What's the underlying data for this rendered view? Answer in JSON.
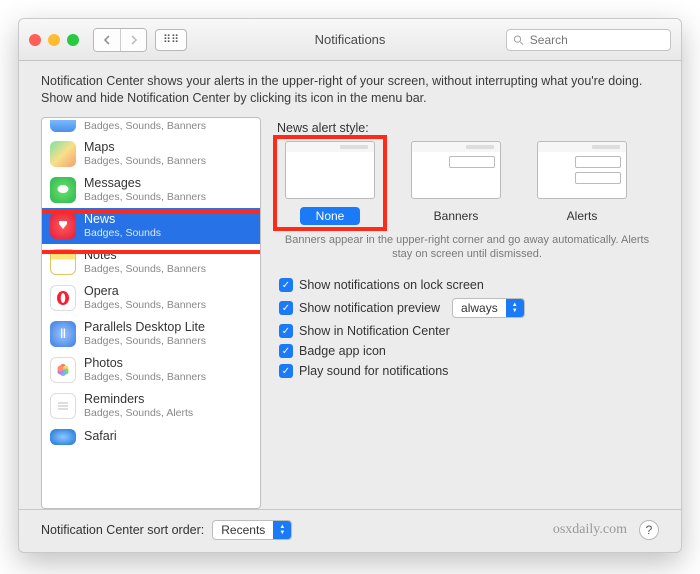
{
  "titlebar": {
    "title": "Notifications",
    "search_placeholder": "Search"
  },
  "description": "Notification Center shows your alerts in the upper-right of your screen, without interrupting what you're doing. Show and hide Notification Center by clicking its icon in the menu bar.",
  "sidebar": {
    "items": [
      {
        "name": "",
        "sub": "Badges, Sounds, Banners"
      },
      {
        "name": "Maps",
        "sub": "Badges, Sounds, Banners"
      },
      {
        "name": "Messages",
        "sub": "Badges, Sounds, Banners"
      },
      {
        "name": "News",
        "sub": "Badges, Sounds"
      },
      {
        "name": "Notes",
        "sub": "Badges, Sounds, Banners"
      },
      {
        "name": "Opera",
        "sub": "Badges, Sounds, Banners"
      },
      {
        "name": "Parallels Desktop Lite",
        "sub": "Badges, Sounds, Banners"
      },
      {
        "name": "Photos",
        "sub": "Badges, Sounds, Banners"
      },
      {
        "name": "Reminders",
        "sub": "Badges, Sounds, Alerts"
      },
      {
        "name": "Safari",
        "sub": ""
      }
    ],
    "selected_index": 3
  },
  "right": {
    "style_label": "News alert style:",
    "styles": {
      "none": "None",
      "banners": "Banners",
      "alerts": "Alerts"
    },
    "selected_style": "none",
    "help_text": "Banners appear in the upper-right corner and go away automatically. Alerts stay on screen until dismissed.",
    "checks": {
      "lock": "Show notifications on lock screen",
      "preview": "Show notification preview",
      "preview_value": "always",
      "center": "Show in Notification Center",
      "badge": "Badge app icon",
      "sound": "Play sound for notifications"
    }
  },
  "footer": {
    "sort_label": "Notification Center sort order:",
    "sort_value": "Recents",
    "watermark": "osxdaily.com"
  }
}
